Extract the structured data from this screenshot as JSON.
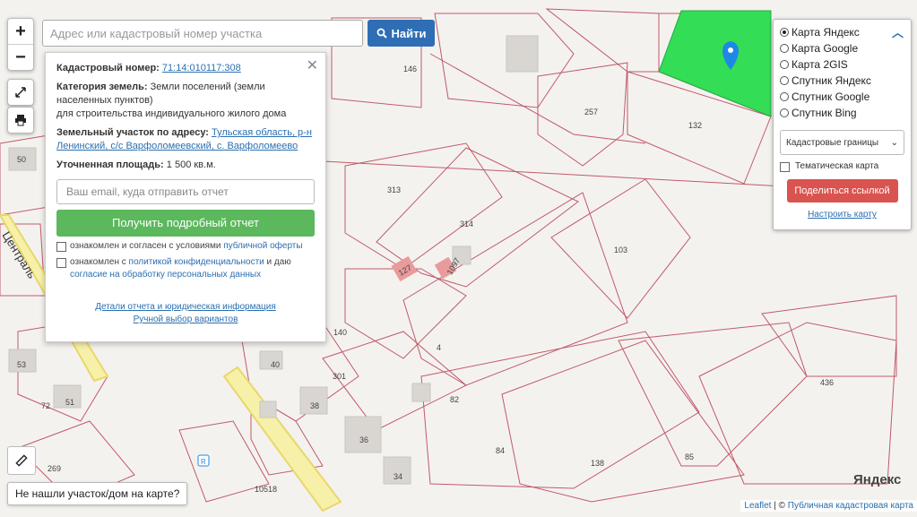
{
  "map": {
    "parcel_labels": [
      "146",
      "257",
      "132",
      "313",
      "314",
      "103",
      "127",
      "1097",
      "4",
      "140",
      "301",
      "82",
      "40",
      "38",
      "36",
      "34",
      "84",
      "138",
      "85",
      "436",
      "50",
      "53",
      "72",
      "51",
      "269",
      "10518"
    ],
    "street_label": "Централь",
    "selected_color": "#33dd55"
  },
  "zoom": {
    "in_label": "+",
    "out_label": "−"
  },
  "search": {
    "placeholder": "Адрес или кадастровый номер участка",
    "button_label": "Найти"
  },
  "info": {
    "cad_label": "Кадастровый номер:",
    "cad_value": "71:14:010117:308",
    "cat_label": "Категория земель:",
    "cat_value": "Земли поселений (земли населенных пунктов)",
    "cat_purpose": "для строительства индивидуального жилого дома",
    "addr_label": "Земельный участок по адресу:",
    "addr_value": "Тульская область, р-н Ленинский, с/с Варфоломеевский, с. Варфоломеево",
    "area_label": "Уточненная площадь:",
    "area_value": "1 500 кв.м.",
    "email_placeholder": "Ваш email, куда отправить отчет",
    "get_report": "Получить подробный отчет",
    "agree1_prefix": "ознакомлен и согласен с условиями",
    "agree1_link": "публичной оферты",
    "agree2_prefix": "ознакомлен с",
    "agree2_link1": "политикой конфиденциальности",
    "agree2_mid": "и даю",
    "agree2_link2": "согласие на обработку персональных данных",
    "details_link": "Детали отчета и юридическая информация",
    "manual_link": "Ручной выбор вариантов"
  },
  "layers": {
    "options": [
      "Карта Яндекс",
      "Карта Google",
      "Карта 2GIS",
      "Спутник Яндекс",
      "Спутник Google",
      "Спутник Bing"
    ],
    "selected": 0,
    "overlay_select": "Кадастровые границы",
    "thematic": "Тематическая карта",
    "share": "Поделиться ссылкой",
    "configure": "Настроить карту"
  },
  "notfound": "Не нашли участок/дом на карте?",
  "attribution": {
    "leaflet": "Leaflet",
    "sep": " | © ",
    "pkk": "Публичная кадастровая карта"
  },
  "yandex_logo": "Яндекс"
}
